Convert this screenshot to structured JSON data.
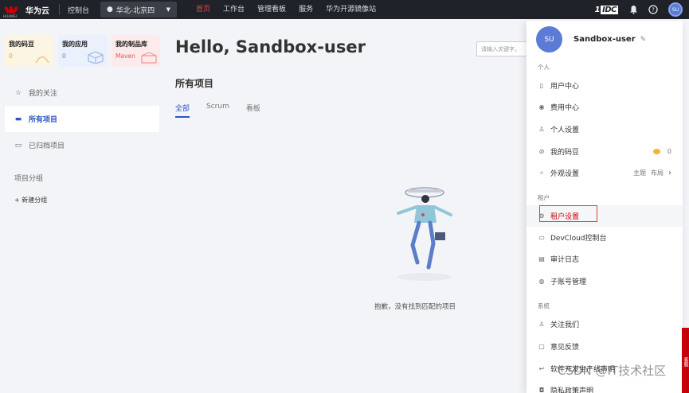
{
  "topnav": {
    "logo_sub": "HUAWEI",
    "brand": "华为云",
    "console": "控制台",
    "region": "华北-北京四",
    "items": [
      {
        "label": "首页",
        "active": true
      },
      {
        "label": "工作台",
        "active": false
      },
      {
        "label": "管理看板",
        "active": false
      },
      {
        "label": "服务",
        "active": false
      },
      {
        "label": "华为开源镜像站",
        "active": false
      }
    ],
    "idc_prefix": "1",
    "idc_label": "IDC",
    "avatar": "SU"
  },
  "sidebar": {
    "cards": [
      {
        "title": "我的码豆",
        "value": "0"
      },
      {
        "title": "我的应用",
        "value": "0"
      },
      {
        "title": "我的制品库",
        "value": "Maven"
      }
    ],
    "menu": [
      {
        "label": "我的关注",
        "icon": "star-icon",
        "glyph": "☆"
      },
      {
        "label": "所有项目",
        "icon": "folder-icon",
        "glyph": "▬"
      },
      {
        "label": "已归档项目",
        "icon": "archive-icon",
        "glyph": "▭"
      }
    ],
    "group_title": "项目分组",
    "new_group": "+ 新建分组"
  },
  "main": {
    "greeting": "Hello, Sandbox-user",
    "search_placeholder": "请输入关键字，",
    "section_title": "所有项目",
    "tabs": [
      {
        "label": "全部",
        "active": true
      },
      {
        "label": "Scrum",
        "active": false
      },
      {
        "label": "看板",
        "active": false
      }
    ],
    "empty_text": "抱歉，没有找到匹配的项目"
  },
  "panel": {
    "avatar": "SU",
    "username": "Sandbox-user",
    "sections": [
      {
        "title": "个人",
        "items": [
          {
            "label": "用户中心",
            "icon": "user-center-icon",
            "glyph": "▯"
          },
          {
            "label": "费用中心",
            "icon": "billing-icon",
            "glyph": "◉"
          },
          {
            "label": "个人设置",
            "icon": "person-icon",
            "glyph": "♙"
          },
          {
            "label": "我的码豆",
            "icon": "bean-icon",
            "glyph": "⊘",
            "right": "0"
          },
          {
            "label": "外观设置",
            "icon": "wand-icon",
            "glyph": "✧",
            "right_a": "主题",
            "right_b": "布局"
          }
        ]
      },
      {
        "title": "租户",
        "items": [
          {
            "label": "租户设置",
            "icon": "tenant-settings-icon",
            "glyph": "⚙"
          },
          {
            "label": "DevCloud控制台",
            "icon": "console-icon",
            "glyph": "▭"
          },
          {
            "label": "审计日志",
            "icon": "audit-log-icon",
            "glyph": "▤"
          },
          {
            "label": "子账号管理",
            "icon": "subaccount-icon",
            "glyph": "◍"
          }
        ]
      },
      {
        "title": "系统",
        "items": [
          {
            "label": "关注我们",
            "icon": "follow-icon",
            "glyph": "♙"
          },
          {
            "label": "意见反馈",
            "icon": "feedback-icon",
            "glyph": "▢"
          },
          {
            "label": "软件开发生产线声明",
            "icon": "statement-icon",
            "glyph": "↩"
          },
          {
            "label": "隐私政策声明",
            "icon": "privacy-icon",
            "glyph": "◘"
          }
        ]
      }
    ]
  },
  "watermark": "CSDN @IT技术社区",
  "side_tab": "客服"
}
